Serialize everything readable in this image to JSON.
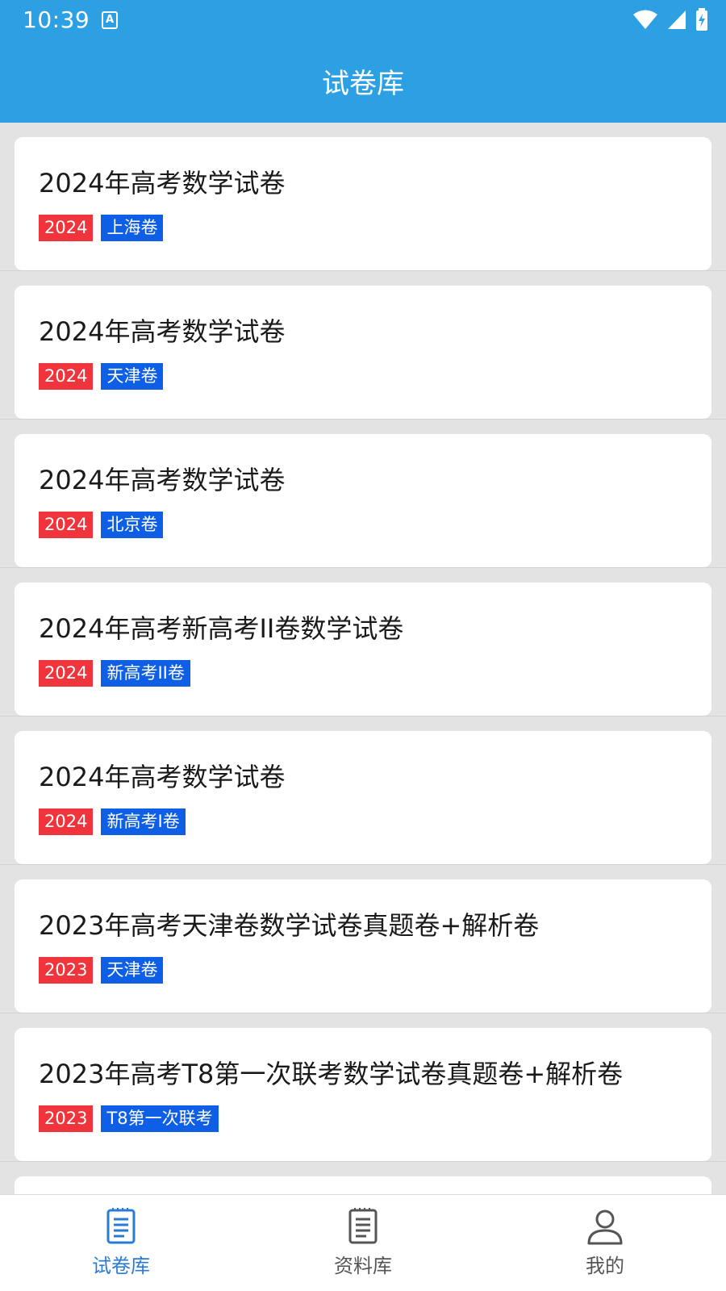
{
  "status_bar": {
    "time": "10:39",
    "notification_icon": "A"
  },
  "app_bar": {
    "title": "试卷库"
  },
  "papers": [
    {
      "title": "2024年高考数学试卷",
      "year_tag": "2024",
      "region_tag": "上海卷"
    },
    {
      "title": "2024年高考数学试卷",
      "year_tag": "2024",
      "region_tag": "天津卷"
    },
    {
      "title": "2024年高考数学试卷",
      "year_tag": "2024",
      "region_tag": "北京卷"
    },
    {
      "title": "2024年高考新高考II卷数学试卷",
      "year_tag": "2024",
      "region_tag": "新高考II卷"
    },
    {
      "title": "2024年高考数学试卷",
      "year_tag": "2024",
      "region_tag": "新高考I卷"
    },
    {
      "title": "2023年高考天津卷数学试卷真题卷+解析卷",
      "year_tag": "2023",
      "region_tag": "天津卷"
    },
    {
      "title": "2023年高考T8第一次联考数学试卷真题卷+解析卷",
      "year_tag": "2023",
      "region_tag": "T8第一次联考"
    }
  ],
  "tab_bar": {
    "tabs": [
      {
        "label": "试卷库",
        "icon": "document-icon",
        "active": true
      },
      {
        "label": "资料库",
        "icon": "document-icon",
        "active": false
      },
      {
        "label": "我的",
        "icon": "user-icon",
        "active": false
      }
    ]
  },
  "colors": {
    "primary": "#2d9fe3",
    "year_tag": "#f0343b",
    "region_tag": "#0f5fe6",
    "active_tab": "#2a7bd6"
  }
}
